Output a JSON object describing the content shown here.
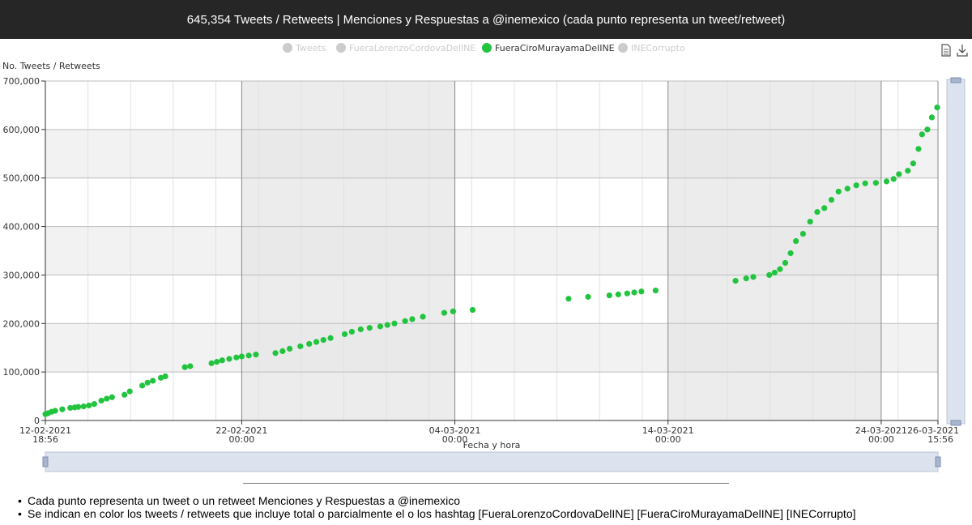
{
  "header": {
    "title": "645,354 Tweets / Retweets | Menciones y Respuestas a @inemexico (cada punto representa un tweet/retweet)"
  },
  "toolbar": {
    "data_view_icon": "document-icon",
    "save_icon": "download-icon"
  },
  "notes": [
    "Cada punto representa un tweet o un retweet Menciones y Respuestas a @inemexico",
    "Se indican en color los tweets / retweets que incluye total o parcialmente el o los hashtag [FueraLorenzoCordovaDelINE] [FueraCiroMurayamaDelINE] [INECorrupto]"
  ],
  "colors": {
    "active_series": "#22c43f",
    "inactive_legend": "#cccccc",
    "band_shade": "#e6e6e6",
    "plot_shade": "#f2f2f2",
    "slider_fill": "#dde3ee"
  },
  "chart_data": {
    "type": "scatter",
    "title": "",
    "xlabel": "Fecha y hora",
    "ylabel": "No. Tweets / Retweets",
    "xlim": [
      "2021-02-12 18:56",
      "2021-03-26 15:56"
    ],
    "ylim": [
      0,
      700000
    ],
    "yticks": [
      {
        "value": 0,
        "label": "0"
      },
      {
        "value": 100000,
        "label": "100,000"
      },
      {
        "value": 200000,
        "label": "200,000"
      },
      {
        "value": 300000,
        "label": "300,000"
      },
      {
        "value": 400000,
        "label": "400,000"
      },
      {
        "value": 500000,
        "label": "500,000"
      },
      {
        "value": 600000,
        "label": "600,000"
      },
      {
        "value": 700000,
        "label": "700,000"
      }
    ],
    "xticks": [
      {
        "value": "2021-02-12 18:56",
        "date": "12-02-2021",
        "time": "18:56"
      },
      {
        "value": "2021-02-22 00:00",
        "date": "22-02-2021",
        "time": "00:00"
      },
      {
        "value": "2021-03-04 00:00",
        "date": "04-03-2021",
        "time": "00:00"
      },
      {
        "value": "2021-03-14 00:00",
        "date": "14-03-2021",
        "time": "00:00"
      },
      {
        "value": "2021-03-24 00:00",
        "date": "24-03-2021",
        "time": "00:00"
      },
      {
        "value": "2021-03-26 15:56",
        "date": "26-03-2021",
        "time": "15:56"
      }
    ],
    "shaded_bands": [
      [
        "2021-02-22 00:00",
        "2021-03-04 00:00"
      ],
      [
        "2021-03-14 00:00",
        "2021-03-24 00:00"
      ]
    ],
    "grid": true,
    "legend_position": "top-center",
    "legend": [
      {
        "name": "Tweets",
        "active": false
      },
      {
        "name": "FueraLorenzoCordovaDelINE",
        "active": false
      },
      {
        "name": "FueraCiroMurayamaDelINE",
        "active": true
      },
      {
        "name": "INECorrupto",
        "active": false
      }
    ],
    "series": [
      {
        "name": "FueraCiroMurayamaDelINE",
        "points": [
          [
            "2021-02-12 19:00",
            13000
          ],
          [
            "2021-02-12 22:00",
            15000
          ],
          [
            "2021-02-13 02:00",
            18000
          ],
          [
            "2021-02-13 06:00",
            20000
          ],
          [
            "2021-02-13 14:00",
            23000
          ],
          [
            "2021-02-13 23:00",
            26000
          ],
          [
            "2021-02-14 04:00",
            27000
          ],
          [
            "2021-02-14 08:00",
            28000
          ],
          [
            "2021-02-14 14:00",
            29000
          ],
          [
            "2021-02-14 20:00",
            31000
          ],
          [
            "2021-02-15 02:00",
            34000
          ],
          [
            "2021-02-15 10:00",
            41000
          ],
          [
            "2021-02-15 16:00",
            45000
          ],
          [
            "2021-02-15 22:00",
            48000
          ],
          [
            "2021-02-16 12:00",
            53000
          ],
          [
            "2021-02-16 18:00",
            60000
          ],
          [
            "2021-02-17 08:00",
            72000
          ],
          [
            "2021-02-17 14:00",
            78000
          ],
          [
            "2021-02-17 20:00",
            82000
          ],
          [
            "2021-02-18 05:00",
            88000
          ],
          [
            "2021-02-18 10:00",
            91000
          ],
          [
            "2021-02-19 08:00",
            110000
          ],
          [
            "2021-02-19 14:00",
            112000
          ],
          [
            "2021-02-20 14:00",
            118000
          ],
          [
            "2021-02-20 20:00",
            121000
          ],
          [
            "2021-02-21 02:00",
            124000
          ],
          [
            "2021-02-21 10:00",
            127000
          ],
          [
            "2021-02-21 18:00",
            130000
          ],
          [
            "2021-02-22 00:00",
            132000
          ],
          [
            "2021-02-22 08:00",
            134000
          ],
          [
            "2021-02-22 16:00",
            136000
          ],
          [
            "2021-02-23 14:00",
            139000
          ],
          [
            "2021-02-23 22:00",
            143000
          ],
          [
            "2021-02-24 06:00",
            148000
          ],
          [
            "2021-02-24 18:00",
            153000
          ],
          [
            "2021-02-25 04:00",
            158000
          ],
          [
            "2021-02-25 12:00",
            162000
          ],
          [
            "2021-02-25 20:00",
            166000
          ],
          [
            "2021-02-26 04:00",
            170000
          ],
          [
            "2021-02-26 20:00",
            178000
          ],
          [
            "2021-02-27 04:00",
            183000
          ],
          [
            "2021-02-27 14:00",
            188000
          ],
          [
            "2021-02-28 00:00",
            191000
          ],
          [
            "2021-02-28 12:00",
            194000
          ],
          [
            "2021-02-28 20:00",
            197000
          ],
          [
            "2021-03-01 04:00",
            200000
          ],
          [
            "2021-03-01 16:00",
            205000
          ],
          [
            "2021-03-02 00:00",
            209000
          ],
          [
            "2021-03-02 12:00",
            214000
          ],
          [
            "2021-03-03 12:00",
            222000
          ],
          [
            "2021-03-03 22:00",
            225000
          ],
          [
            "2021-03-04 20:00",
            228000
          ],
          [
            "2021-03-09 08:00",
            251000
          ],
          [
            "2021-03-10 06:00",
            255000
          ],
          [
            "2021-03-11 06:00",
            258000
          ],
          [
            "2021-03-11 16:00",
            260000
          ],
          [
            "2021-03-12 02:00",
            262000
          ],
          [
            "2021-03-12 10:00",
            264000
          ],
          [
            "2021-03-12 18:00",
            266000
          ],
          [
            "2021-03-13 10:00",
            268000
          ],
          [
            "2021-03-17 04:00",
            288000
          ],
          [
            "2021-03-17 16:00",
            293000
          ],
          [
            "2021-03-18 00:00",
            296000
          ],
          [
            "2021-03-18 18:00",
            300000
          ],
          [
            "2021-03-19 00:00",
            305000
          ],
          [
            "2021-03-19 06:00",
            312000
          ],
          [
            "2021-03-19 12:00",
            325000
          ],
          [
            "2021-03-19 18:00",
            345000
          ],
          [
            "2021-03-20 00:00",
            370000
          ],
          [
            "2021-03-20 08:00",
            385000
          ],
          [
            "2021-03-20 16:00",
            410000
          ],
          [
            "2021-03-21 00:00",
            430000
          ],
          [
            "2021-03-21 08:00",
            438000
          ],
          [
            "2021-03-21 16:00",
            455000
          ],
          [
            "2021-03-22 00:00",
            472000
          ],
          [
            "2021-03-22 10:00",
            478000
          ],
          [
            "2021-03-22 20:00",
            485000
          ],
          [
            "2021-03-23 06:00",
            489000
          ],
          [
            "2021-03-23 18:00",
            490000
          ],
          [
            "2021-03-24 06:00",
            493000
          ],
          [
            "2021-03-24 14:00",
            498000
          ],
          [
            "2021-03-24 20:00",
            508000
          ],
          [
            "2021-03-25 06:00",
            515000
          ],
          [
            "2021-03-25 12:00",
            530000
          ],
          [
            "2021-03-25 18:00",
            560000
          ],
          [
            "2021-03-25 22:00",
            590000
          ],
          [
            "2021-03-26 04:00",
            600000
          ],
          [
            "2021-03-26 09:00",
            625000
          ],
          [
            "2021-03-26 15:00",
            645354
          ]
        ]
      }
    ]
  }
}
